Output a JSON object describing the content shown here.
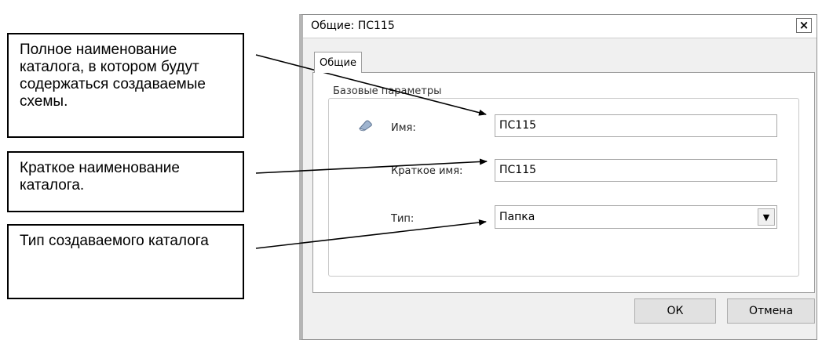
{
  "callouts": [
    {
      "text": "Полное наименование каталога, в котором будут содержаться создаваемые схемы."
    },
    {
      "text": "Краткое наименование каталога."
    },
    {
      "text": "Тип создаваемого каталога"
    }
  ],
  "dialog": {
    "title": "Общие: ПС115",
    "close_label": "×",
    "tab_label": "Общие",
    "group_label": "Базовые параметры",
    "fields": {
      "name_label": "Имя:",
      "name_value": "ПС115",
      "short_label": "Краткое имя:",
      "short_value": "ПС115",
      "type_label": "Тип:",
      "type_value": "Папка"
    },
    "ok_label": "ОК",
    "cancel_label": "Отмена"
  },
  "icons": [
    "eraser-icon",
    "close-icon",
    "dropdown-arrow-icon"
  ]
}
